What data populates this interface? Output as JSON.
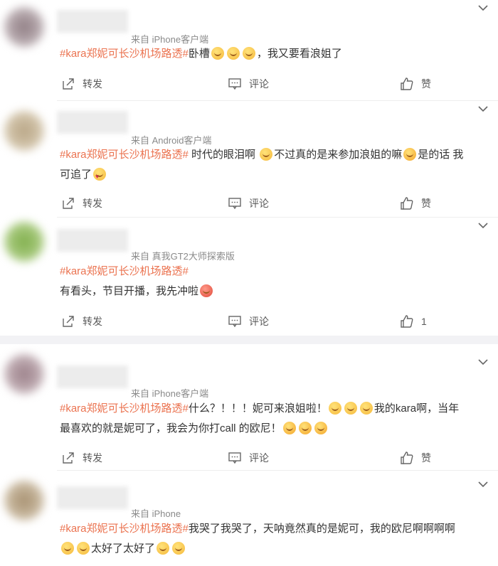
{
  "posts": [
    {
      "source": "来自 iPhone客户端",
      "hashtag": "#kara郑妮可长沙机场路透#",
      "text_1": "卧槽",
      "text_2": "，我又要看浪姐了",
      "actions": {
        "share": "转发",
        "comment": "评论",
        "like": "赞"
      }
    },
    {
      "source": "来自 Android客户端",
      "hashtag": "#kara郑妮可长沙机场路透#",
      "text_1": " 时代的眼泪啊 ",
      "text_2": "不过真的是来参加浪姐的嘛",
      "text_3": "是的话 我",
      "text_4": "可追了",
      "actions": {
        "share": "转发",
        "comment": "评论",
        "like": "赞"
      }
    },
    {
      "source": "来自 真我GT2大师探索版",
      "hashtag": "#kara郑妮可长沙机场路透#",
      "text_1": "有看头，节目开播，我先冲啦",
      "actions": {
        "share": "转发",
        "comment": "评论",
        "like": "1"
      }
    },
    {
      "source": "来自 iPhone客户端",
      "hashtag": "#kara郑妮可长沙机场路透#",
      "text_1": "什么？！！！妮可来浪姐啦！",
      "text_2": "我的kara啊，当年",
      "text_3": "最喜欢的就是妮可了，我会为你打call 的欧尼！",
      "actions": {
        "share": "转发",
        "comment": "评论",
        "like": "赞"
      }
    },
    {
      "source": "来自 iPhone",
      "hashtag": "#kara郑妮可长沙机场路透#",
      "text_1": "我哭了我哭了，天呐竟然真的是妮可，我的欧尼啊啊啊啊",
      "text_2": "太好了太好了"
    }
  ],
  "colors": {
    "hashtag": "#eb7350",
    "muted": "#8a8a8a",
    "text": "#333333"
  },
  "icons": [
    "chevron-down-icon",
    "share-icon",
    "comment-icon",
    "like-icon",
    "emoji-icon"
  ]
}
